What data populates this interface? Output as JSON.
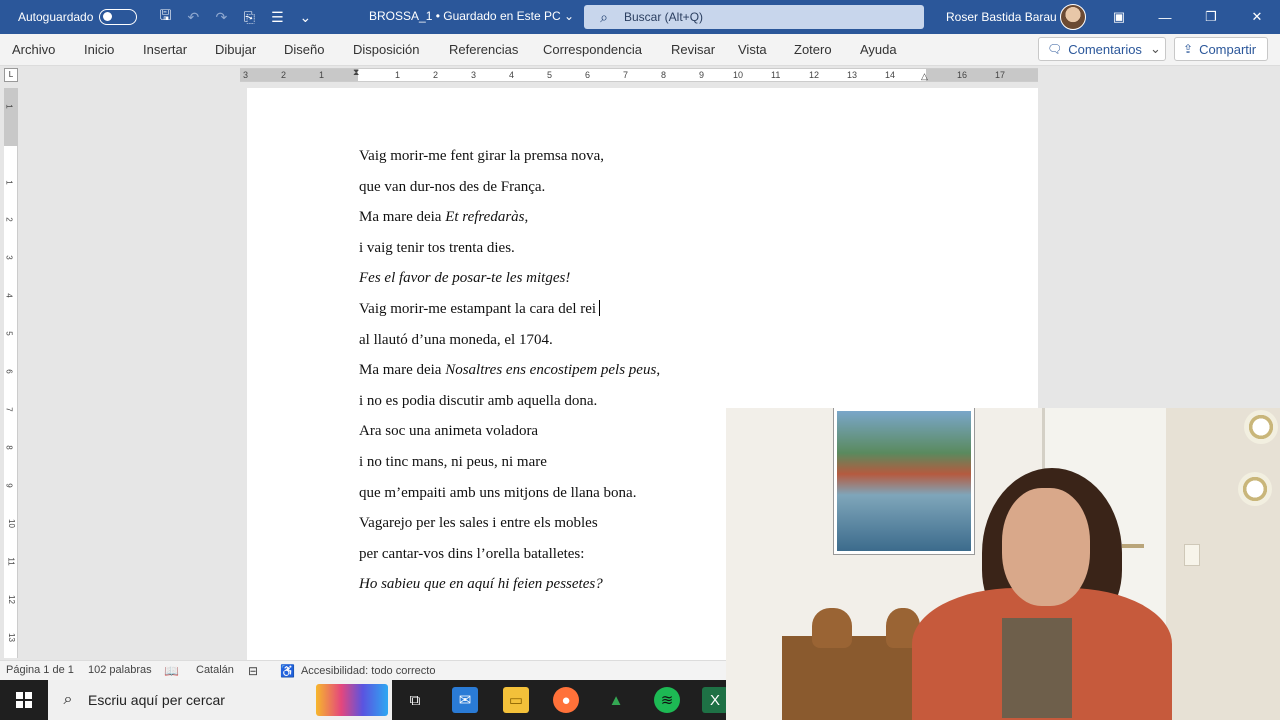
{
  "titlebar": {
    "autosave_label": "Autoguardado",
    "doc_title": "BROSSA_1 • Guardado en Este PC",
    "doc_title_chevron": "⌄",
    "search_placeholder": "Buscar (Alt+Q)",
    "user_name": "Roser Bastida Barau",
    "colors": {
      "bar": "#2b579a"
    }
  },
  "ribbon": {
    "tabs": [
      "Archivo",
      "Inicio",
      "Insertar",
      "Dibujar",
      "Diseño",
      "Disposición",
      "Referencias",
      "Correspondencia",
      "Revisar",
      "Vista",
      "Zotero",
      "Ayuda"
    ],
    "comments_label": "Comentarios",
    "share_label": "Compartir"
  },
  "ruler": {
    "h_numbers": [
      "3",
      "2",
      "1",
      "1",
      "1",
      "2",
      "3",
      "4",
      "5",
      "6",
      "7",
      "8",
      "9",
      "10",
      "11",
      "12",
      "13",
      "14",
      "16",
      "17"
    ],
    "v_numbers": [
      "1",
      "1",
      "2",
      "3",
      "4",
      "5",
      "6",
      "7",
      "8",
      "9",
      "10",
      "11",
      "12",
      "13"
    ]
  },
  "document": {
    "lines": [
      [
        {
          "t": "Vaig morir-me fent girar la premsa nova,",
          "i": false
        }
      ],
      [
        {
          "t": "que van dur-nos des de França.",
          "i": false
        }
      ],
      [
        {
          "t": "Ma mare deia ",
          "i": false
        },
        {
          "t": "Et refredaràs",
          "i": true
        },
        {
          "t": ",",
          "i": false
        }
      ],
      [
        {
          "t": "i vaig tenir tos trenta dies.",
          "i": false
        }
      ],
      [
        {
          "t": "Fes el favor de posar-te les mitges!",
          "i": true
        }
      ],
      [
        {
          "t": "Vaig morir-me estampant la cara del rei",
          "i": false
        }
      ],
      [
        {
          "t": "al llautó d’una moneda, el 1704.",
          "i": false
        }
      ],
      [
        {
          "t": "Ma mare deia ",
          "i": false
        },
        {
          "t": "Nosaltres ens encostipem pels peus",
          "i": true
        },
        {
          "t": ",",
          "i": false
        }
      ],
      [
        {
          "t": "i no es podia discutir amb aquella dona.",
          "i": false
        }
      ],
      [
        {
          "t": "Ara soc una animeta voladora",
          "i": false
        }
      ],
      [
        {
          "t": "i no tinc mans, ni peus, ni mare",
          "i": false
        }
      ],
      [
        {
          "t": "que m’empaiti amb uns mitjons de llana bona.",
          "i": false
        }
      ],
      [
        {
          "t": "Vagarejo per les sales i entre els mobles",
          "i": false
        }
      ],
      [
        {
          "t": "per cantar-vos dins l’orella batalletes:",
          "i": false
        }
      ],
      [
        {
          "t": "Ho sabieu que en aquí hi feien pessetes?",
          "i": true
        }
      ]
    ]
  },
  "statusbar": {
    "page": "Página 1 de 1",
    "words": "102 palabras",
    "language": "Catalán",
    "accessibility": "Accesibilidad: todo correcto"
  },
  "taskbar": {
    "search_placeholder": "Escriu aquí per cercar",
    "apps": [
      "task-view",
      "mail",
      "file-explorer",
      "firefox",
      "google-drive",
      "spotify",
      "excel"
    ]
  }
}
